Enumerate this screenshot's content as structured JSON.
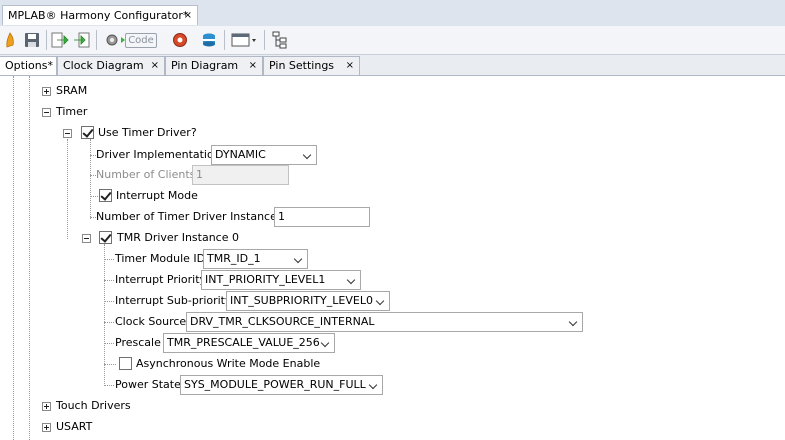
{
  "window": {
    "title": "MPLAB® Harmony Configurator*",
    "close": "×"
  },
  "toolbar": {
    "code_label": "Code"
  },
  "tabs": [
    {
      "label": "Options*",
      "close": ""
    },
    {
      "label": "Clock Diagram",
      "close": "×"
    },
    {
      "label": "Pin Diagram",
      "close": "×"
    },
    {
      "label": "Pin Settings",
      "close": "×"
    }
  ],
  "tree": {
    "sram": "SRAM",
    "timer": "Timer",
    "use_timer_driver": "Use Timer Driver?",
    "driver_impl": {
      "label": "Driver Implementation",
      "value": "DYNAMIC"
    },
    "num_clients": {
      "label": "Number of Clients",
      "value": "1"
    },
    "interrupt_mode": "Interrupt Mode",
    "num_instances": {
      "label": "Number of Timer Driver Instances",
      "value": "1"
    },
    "instance0": "TMR Driver Instance 0",
    "module_id": {
      "label": "Timer Module ID",
      "value": "TMR_ID_1"
    },
    "int_priority": {
      "label": "Interrupt Priority",
      "value": "INT_PRIORITY_LEVEL1"
    },
    "int_subpriority": {
      "label": "Interrupt Sub-priority",
      "value": "INT_SUBPRIORITY_LEVEL0"
    },
    "clock_source": {
      "label": "Clock Source",
      "value": "DRV_TMR_CLKSOURCE_INTERNAL"
    },
    "prescale": {
      "label": "Prescale",
      "value": "TMR_PRESCALE_VALUE_256"
    },
    "async_write": "Asynchronous Write Mode Enable",
    "power_state": {
      "label": "Power State",
      "value": "SYS_MODULE_POWER_RUN_FULL"
    },
    "touch": "Touch Drivers",
    "usart": "USART"
  },
  "state": {
    "use_timer_driver": true,
    "interrupt_mode": true,
    "instance0": true,
    "async_write": false
  }
}
